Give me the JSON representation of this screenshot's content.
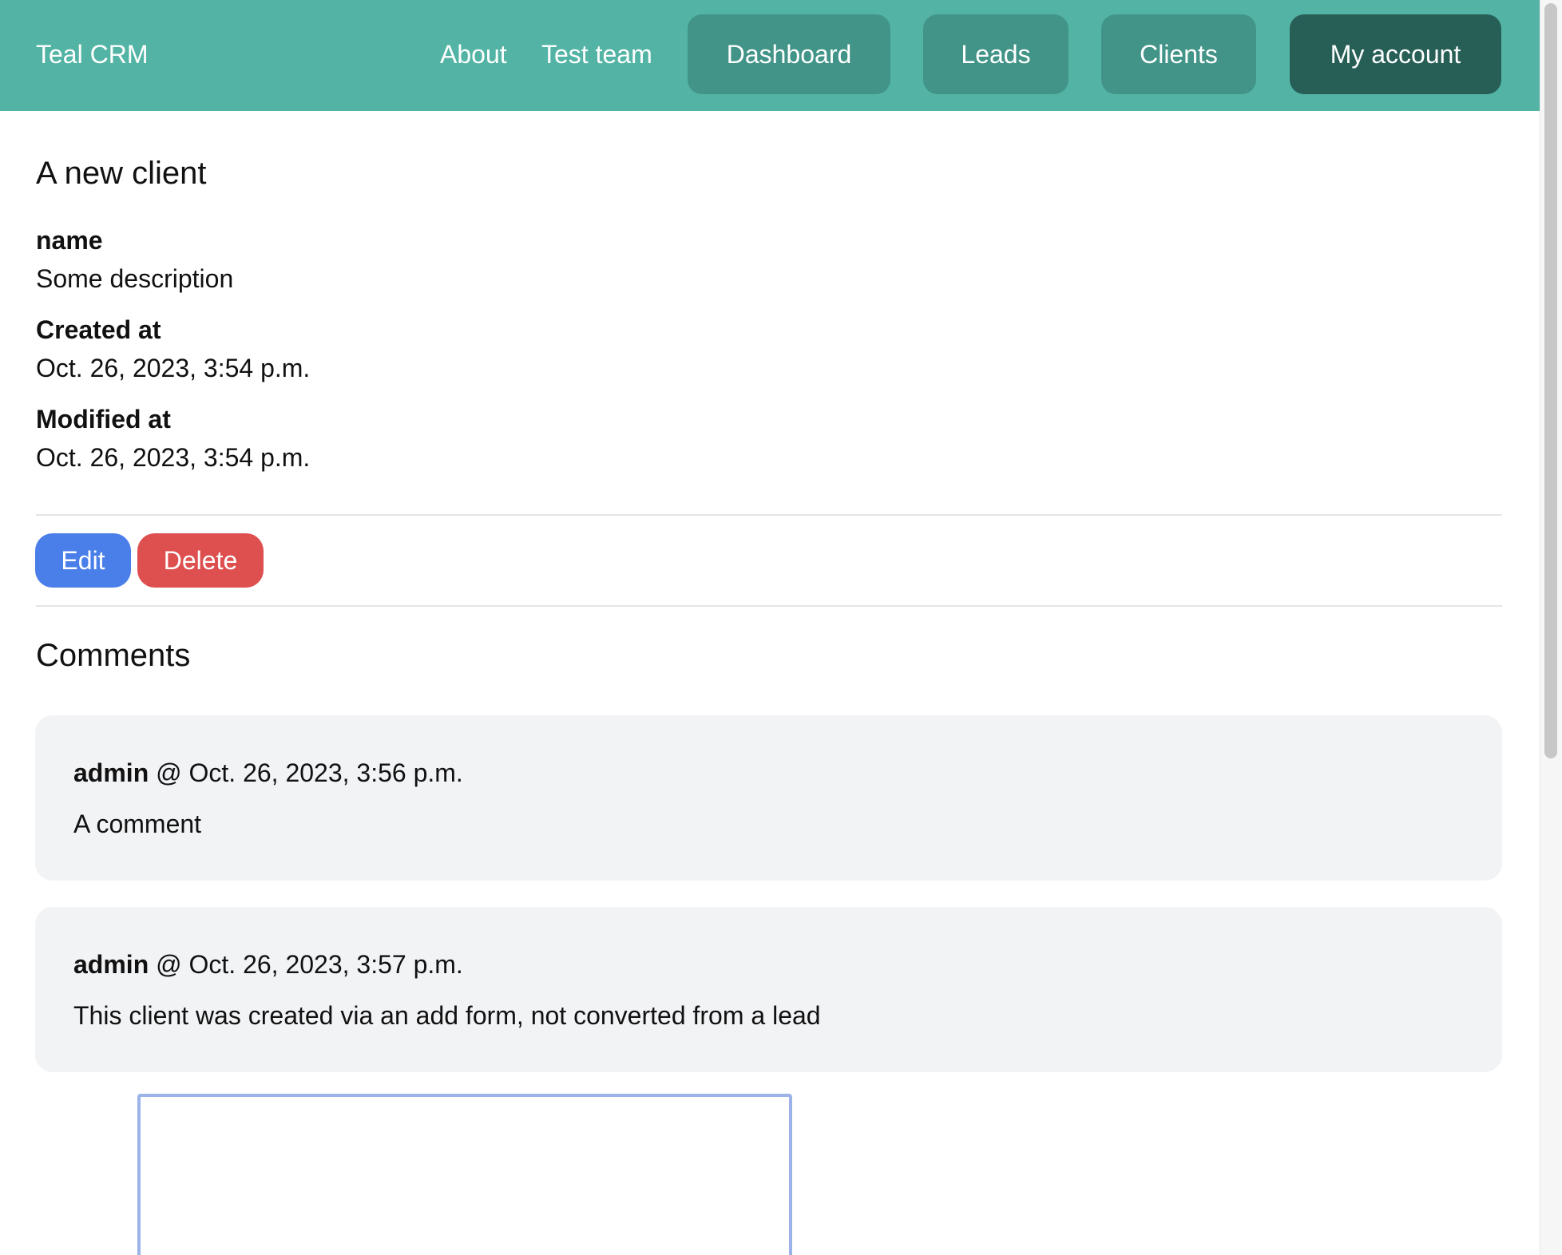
{
  "nav": {
    "brand": "Teal CRM",
    "links": [
      "About",
      "Test team"
    ],
    "buttons": [
      "Dashboard",
      "Leads",
      "Clients"
    ],
    "account_button": "My account"
  },
  "client": {
    "title": "A new client",
    "fields": [
      {
        "label": "name",
        "value": "Some description"
      },
      {
        "label": "Created at",
        "value": "Oct. 26, 2023, 3:54 p.m."
      },
      {
        "label": "Modified at",
        "value": "Oct. 26, 2023, 3:54 p.m."
      }
    ]
  },
  "actions": {
    "edit": "Edit",
    "delete": "Delete"
  },
  "comments": {
    "title": "Comments",
    "items": [
      {
        "author": "admin",
        "separator": "@",
        "timestamp": "Oct. 26, 2023, 3:56 p.m.",
        "text": "A comment"
      },
      {
        "author": "admin",
        "separator": "@",
        "timestamp": "Oct. 26, 2023, 3:57 p.m.",
        "text": "This client was created via an add form, not converted from a lead"
      }
    ],
    "new_comment_value": ""
  },
  "colors": {
    "navbar": "#53b4a5",
    "nav_button": "#419487",
    "account_button": "#275f57",
    "edit": "#4a7fe9",
    "delete": "#de4f4f",
    "comment_bg": "#f2f3f5"
  }
}
